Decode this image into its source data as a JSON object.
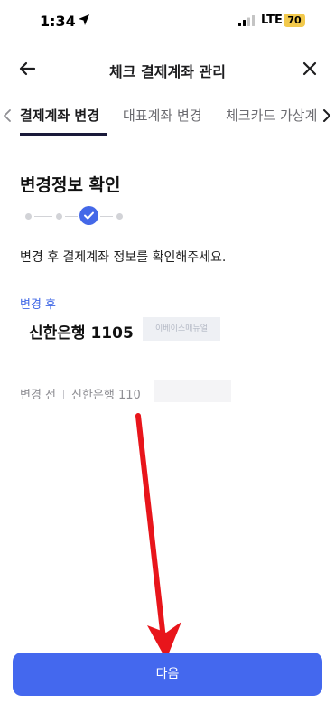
{
  "status_bar": {
    "time": "1:34",
    "network": "LTE",
    "battery": "70"
  },
  "header": {
    "title": "체크 결제계좌 관리"
  },
  "tabs": [
    {
      "label": "결제계좌 변경",
      "active": true
    },
    {
      "label": "대표계좌 변경",
      "active": false
    },
    {
      "label": "체크카드 가상계좌",
      "active": false
    }
  ],
  "main": {
    "section_title": "변경정보 확인",
    "stepper": {
      "total_steps": 5,
      "current_step": 4
    },
    "description": "변경 후 결제계좌 정보를 확인해주세요.",
    "after": {
      "label": "변경 후",
      "value": "신한은행  1105",
      "watermark": "이베이스매뉴얼"
    },
    "before": {
      "label": "변경 전",
      "value": "신한은행 110"
    }
  },
  "footer": {
    "next_label": "다음"
  },
  "colors": {
    "accent": "#4468ee",
    "after_label": "#3f67e6",
    "annotation": "#e8151b",
    "battery": "#f2c94c"
  },
  "icons": [
    "location-arrow-icon",
    "signal-icon",
    "back-arrow-icon",
    "close-icon",
    "chevron-left-icon",
    "chevron-right-icon",
    "check-icon"
  ]
}
